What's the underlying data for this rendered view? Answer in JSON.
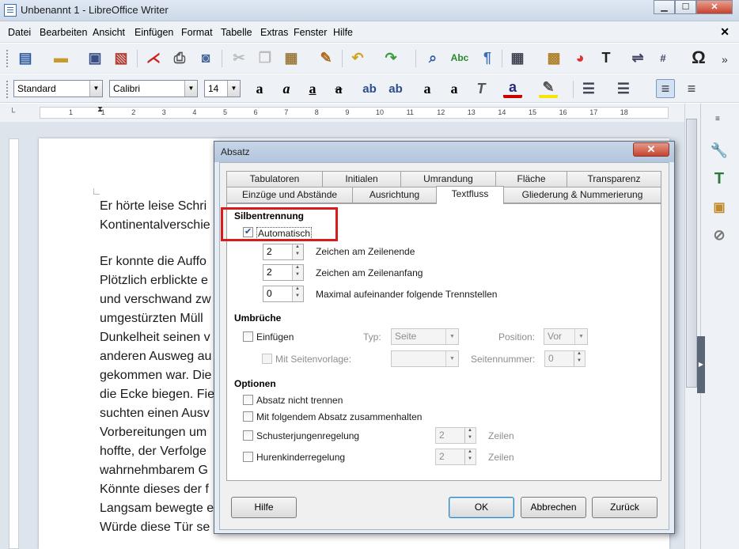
{
  "window": {
    "title": "Unbenannt 1 - LibreOffice Writer",
    "min": "▁",
    "max": "☐",
    "close": "✕"
  },
  "menu": [
    "Datei",
    "Bearbeiten",
    "Ansicht",
    "Einfügen",
    "Format",
    "Tabelle",
    "Extras",
    "Fenster",
    "Hilfe"
  ],
  "doc_close": "✕",
  "formatting": {
    "style": "Standard",
    "font": "Calibri",
    "size": "14"
  },
  "document_lines": [
    "Er hörte leise Schri",
    "Kontinentalverschie",
    "Er konnte die Auffo",
    "Plötzlich erblickte e",
    "und verschwand zw",
    "umgestürzten Müll",
    "Dunkelheit seinen v",
    "anderen Ausweg au",
    "gekommen war. Die",
    "die Ecke biegen. Fie",
    "suchten einen Ausv",
    "Vorbereitungen um",
    "hoffte, der Verfolge",
    "wahrnehmbarem G",
    "Könnte dieses der f",
    "Langsam bewegte e",
    "Würde diese Tür se"
  ],
  "dialog": {
    "title": "Absatz",
    "close": "✕",
    "tabs_row1": [
      "Tabulatoren",
      "Initialen",
      "Umrandung",
      "Fläche",
      "Transparenz"
    ],
    "tabs_row2": [
      "Einzüge und Abstände",
      "Ausrichtung",
      "Textfluss",
      "Gliederung & Nummerierung"
    ],
    "active_tab": "Textfluss",
    "silben": {
      "heading": "Silbentrennung",
      "auto_label": "Automatisch",
      "auto_checked": true,
      "fields": [
        {
          "value": "2",
          "label": "Zeichen am Zeilenende"
        },
        {
          "value": "2",
          "label": "Zeichen am Zeilenanfang"
        },
        {
          "value": "0",
          "label": "Maximal aufeinander folgende Trennstellen"
        }
      ]
    },
    "umbrueche": {
      "heading": "Umbrüche",
      "einfuegen": "Einfügen",
      "typ_label": "Typ:",
      "typ_value": "Seite",
      "position_label": "Position:",
      "position_value": "Vor",
      "mit_seitenvorlage": "Mit Seitenvorlage:",
      "seitennummer_label": "Seitennummer:",
      "seitennummer_value": "0"
    },
    "optionen": {
      "heading": "Optionen",
      "items": [
        "Absatz nicht trennen",
        "Mit folgendem Absatz zusammenhalten",
        "Schusterjungenregelung",
        "Hurenkinderregelung"
      ],
      "schuster_value": "2",
      "huren_value": "2",
      "zeilen": "Zeilen"
    },
    "buttons": {
      "help": "Hilfe",
      "ok": "OK",
      "cancel": "Abbrechen",
      "reset": "Zurück"
    }
  },
  "ruler_numbers": [
    "1",
    "1",
    "2",
    "3",
    "4",
    "5",
    "6",
    "7",
    "8",
    "9",
    "10",
    "11",
    "12",
    "13",
    "14",
    "15",
    "16",
    "17",
    "18"
  ],
  "colors": {
    "highlight": "#d81b1b",
    "accent": "#3c7fb1"
  }
}
